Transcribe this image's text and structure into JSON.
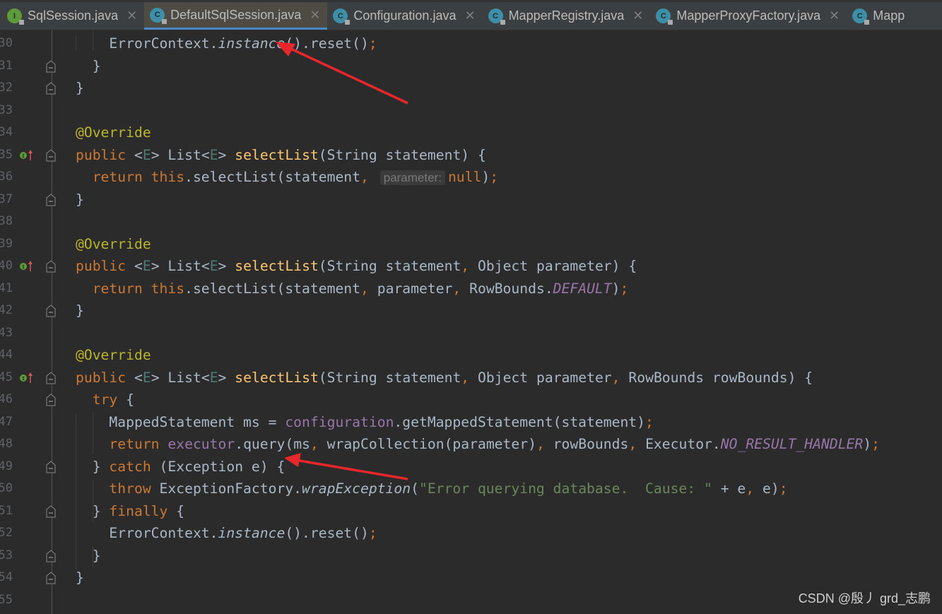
{
  "tabs": [
    {
      "label": "SqlSession.java",
      "icon": "interface-icon",
      "letter": "I",
      "active": false
    },
    {
      "label": "DefaultSqlSession.java",
      "icon": "class-icon",
      "letter": "C",
      "active": true
    },
    {
      "label": "Configuration.java",
      "icon": "class-icon",
      "letter": "C",
      "active": false
    },
    {
      "label": "MapperRegistry.java",
      "icon": "class-icon",
      "letter": "C",
      "active": false
    },
    {
      "label": "MapperProxyFactory.java",
      "icon": "class-icon",
      "letter": "C",
      "active": false
    },
    {
      "label": "Mapp",
      "icon": "class-icon",
      "letter": "C",
      "active": false
    }
  ],
  "close_glyph": "✕",
  "colors": {
    "background": "#2b2b2b",
    "keyword": "#cc7832",
    "method": "#ffc66d",
    "annotation": "#bbb529",
    "field": "#9876aa",
    "string": "#6a8759",
    "text": "#a9b7c6",
    "arrow": "#e8262b"
  },
  "lines": [
    {
      "n": "30",
      "t": [
        [
          "",
          "    ErrorContext."
        ],
        [
          "it",
          "instance"
        ],
        [
          "",
          "().reset()"
        ],
        [
          "kw",
          ";"
        ]
      ]
    },
    {
      "n": "31",
      "fold": true,
      "t": [
        [
          "",
          "  }"
        ]
      ]
    },
    {
      "n": "32",
      "fold": true,
      "t": [
        [
          "",
          "}"
        ]
      ]
    },
    {
      "n": "33",
      "t": []
    },
    {
      "n": "34",
      "t": [
        [
          "an",
          "@Override"
        ]
      ]
    },
    {
      "n": "35",
      "impl": true,
      "fold": true,
      "t": [
        [
          "kw",
          "public "
        ],
        [
          "",
          "<"
        ],
        [
          "ge",
          "E"
        ],
        [
          "",
          "> List<"
        ],
        [
          "ge",
          "E"
        ],
        [
          "",
          "> "
        ],
        [
          "fn",
          "selectList"
        ],
        [
          "",
          "(String statement) {"
        ]
      ]
    },
    {
      "n": "36",
      "t": [
        [
          "kw",
          "  return this"
        ],
        [
          "",
          ".selectList(statement"
        ],
        [
          "kw",
          ", "
        ],
        [
          "hint",
          "parameter:"
        ],
        [
          "kw",
          "null"
        ],
        [
          "",
          ")"
        ],
        [
          "kw",
          ";"
        ]
      ]
    },
    {
      "n": "37",
      "fold": true,
      "t": [
        [
          "",
          "}"
        ]
      ]
    },
    {
      "n": "38",
      "t": []
    },
    {
      "n": "39",
      "t": [
        [
          "an",
          "@Override"
        ]
      ]
    },
    {
      "n": "40",
      "impl": true,
      "fold": true,
      "t": [
        [
          "kw",
          "public "
        ],
        [
          "",
          "<"
        ],
        [
          "ge",
          "E"
        ],
        [
          "",
          "> List<"
        ],
        [
          "ge",
          "E"
        ],
        [
          "",
          "> "
        ],
        [
          "fn",
          "selectList"
        ],
        [
          "",
          "(String statement"
        ],
        [
          "kw",
          ", "
        ],
        [
          "",
          "Object parameter) {"
        ]
      ]
    },
    {
      "n": "41",
      "t": [
        [
          "kw",
          "  return this"
        ],
        [
          "",
          ".selectList(statement"
        ],
        [
          "kw",
          ", "
        ],
        [
          "",
          "parameter"
        ],
        [
          "kw",
          ", "
        ],
        [
          "",
          "RowBounds."
        ],
        [
          "fi",
          "DEFAULT"
        ],
        [
          "",
          ")"
        ],
        [
          "kw",
          ";"
        ]
      ]
    },
    {
      "n": "42",
      "fold": true,
      "t": [
        [
          "",
          "}"
        ]
      ]
    },
    {
      "n": "43",
      "t": []
    },
    {
      "n": "44",
      "t": [
        [
          "an",
          "@Override"
        ]
      ]
    },
    {
      "n": "45",
      "impl": true,
      "fold": true,
      "t": [
        [
          "kw",
          "public "
        ],
        [
          "",
          "<"
        ],
        [
          "ge",
          "E"
        ],
        [
          "",
          "> List<"
        ],
        [
          "ge",
          "E"
        ],
        [
          "",
          "> "
        ],
        [
          "fn",
          "selectList"
        ],
        [
          "",
          "(String statement"
        ],
        [
          "kw",
          ", "
        ],
        [
          "",
          "Object parameter"
        ],
        [
          "kw",
          ", "
        ],
        [
          "",
          "RowBounds rowBounds) {"
        ]
      ]
    },
    {
      "n": "46",
      "fold": true,
      "t": [
        [
          "kw",
          "  try "
        ],
        [
          "",
          "{"
        ]
      ]
    },
    {
      "n": "47",
      "t": [
        [
          "",
          "    MappedStatement ms = "
        ],
        [
          "fd",
          "configuration"
        ],
        [
          "",
          ".getMappedStatement(statement)"
        ],
        [
          "kw",
          ";"
        ]
      ]
    },
    {
      "n": "48",
      "t": [
        [
          "kw",
          "    return "
        ],
        [
          "fd",
          "executor"
        ],
        [
          "",
          ".query(ms"
        ],
        [
          "kw",
          ", "
        ],
        [
          "",
          "wrapCollection(parameter)"
        ],
        [
          "kw",
          ", "
        ],
        [
          "",
          "rowBounds"
        ],
        [
          "kw",
          ", "
        ],
        [
          "",
          "Executor."
        ],
        [
          "fi",
          "NO_RESULT_HANDLER"
        ],
        [
          "",
          ")"
        ],
        [
          "kw",
          ";"
        ]
      ]
    },
    {
      "n": "49",
      "fold": true,
      "t": [
        [
          "",
          "  } "
        ],
        [
          "kw",
          "catch "
        ],
        [
          "",
          "(Exception e) {"
        ]
      ]
    },
    {
      "n": "50",
      "t": [
        [
          "kw",
          "    throw "
        ],
        [
          "",
          "ExceptionFactory."
        ],
        [
          "it",
          "wrapException"
        ],
        [
          "",
          "("
        ],
        [
          "st",
          "\"Error querying database.  Cause: \""
        ],
        [
          "",
          " + e"
        ],
        [
          "kw",
          ", "
        ],
        [
          "",
          "e)"
        ],
        [
          "kw",
          ";"
        ]
      ]
    },
    {
      "n": "51",
      "fold": true,
      "t": [
        [
          "",
          "  } "
        ],
        [
          "kw",
          "finally "
        ],
        [
          "",
          "{"
        ]
      ]
    },
    {
      "n": "52",
      "t": [
        [
          "",
          "    ErrorContext."
        ],
        [
          "it",
          "instance"
        ],
        [
          "",
          "().reset()"
        ],
        [
          "kw",
          ";"
        ]
      ]
    },
    {
      "n": "53",
      "fold": true,
      "t": [
        [
          "",
          "  }"
        ]
      ]
    },
    {
      "n": "54",
      "fold": true,
      "t": [
        [
          "",
          "}"
        ]
      ]
    },
    {
      "n": "55",
      "t": []
    }
  ],
  "watermark": "CSDN @殷丿 grd_志鹏"
}
